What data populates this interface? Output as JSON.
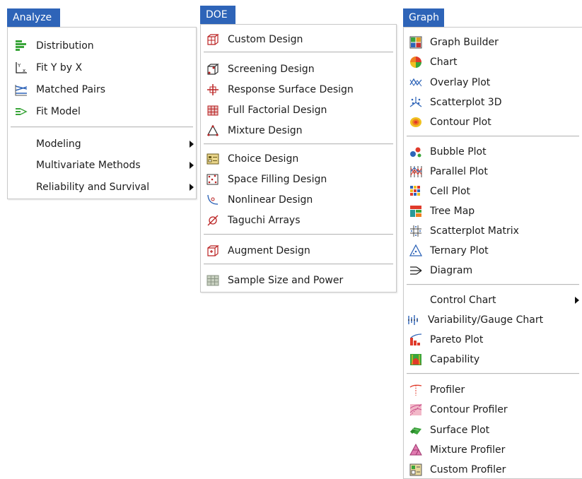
{
  "colors": {
    "title_bg": "#2e64b8",
    "title_text": "#ffffff"
  },
  "analyze": {
    "title": "Analyze",
    "items": [
      {
        "label": "Distribution",
        "icon": "distribution-icon"
      },
      {
        "label": "Fit Y by X",
        "icon": "fit-y-by-x-icon"
      },
      {
        "label": "Matched Pairs",
        "icon": "matched-pairs-icon"
      },
      {
        "label": "Fit Model",
        "icon": "fit-model-icon"
      },
      {
        "label": "Modeling"
      },
      {
        "label": "Multivariate Methods"
      },
      {
        "label": "Reliability and Survival"
      }
    ]
  },
  "doe": {
    "title": "DOE",
    "items": [
      {
        "label": "Custom Design",
        "icon": "custom-design-icon"
      },
      {
        "label": "Screening Design",
        "icon": "screening-design-icon"
      },
      {
        "label": "Response Surface Design",
        "icon": "response-surface-icon"
      },
      {
        "label": "Full Factorial Design",
        "icon": "full-factorial-icon"
      },
      {
        "label": "Mixture Design",
        "icon": "mixture-design-icon"
      },
      {
        "label": "Choice Design",
        "icon": "choice-design-icon"
      },
      {
        "label": "Space Filling Design",
        "icon": "space-filling-icon"
      },
      {
        "label": "Nonlinear Design",
        "icon": "nonlinear-design-icon"
      },
      {
        "label": "Taguchi Arrays",
        "icon": "taguchi-arrays-icon"
      },
      {
        "label": "Augment Design",
        "icon": "augment-design-icon"
      },
      {
        "label": "Sample Size and Power",
        "icon": "sample-size-icon"
      }
    ]
  },
  "graph": {
    "title": "Graph",
    "items": [
      {
        "label": "Graph Builder",
        "icon": "graph-builder-icon"
      },
      {
        "label": "Chart",
        "icon": "chart-icon"
      },
      {
        "label": "Overlay Plot",
        "icon": "overlay-plot-icon"
      },
      {
        "label": "Scatterplot 3D",
        "icon": "scatterplot-3d-icon"
      },
      {
        "label": "Contour Plot",
        "icon": "contour-plot-icon"
      },
      {
        "label": "Bubble Plot",
        "icon": "bubble-plot-icon"
      },
      {
        "label": "Parallel Plot",
        "icon": "parallel-plot-icon"
      },
      {
        "label": "Cell Plot",
        "icon": "cell-plot-icon"
      },
      {
        "label": "Tree Map",
        "icon": "tree-map-icon"
      },
      {
        "label": "Scatterplot Matrix",
        "icon": "scatterplot-matrix-icon"
      },
      {
        "label": "Ternary Plot",
        "icon": "ternary-plot-icon"
      },
      {
        "label": "Diagram",
        "icon": "diagram-icon"
      },
      {
        "label": "Control Chart"
      },
      {
        "label": "Variability/Gauge Chart",
        "icon": "variability-chart-icon"
      },
      {
        "label": "Pareto Plot",
        "icon": "pareto-plot-icon"
      },
      {
        "label": "Capability",
        "icon": "capability-icon"
      },
      {
        "label": "Profiler",
        "icon": "profiler-icon"
      },
      {
        "label": "Contour Profiler",
        "icon": "contour-profiler-icon"
      },
      {
        "label": "Surface Plot",
        "icon": "surface-plot-icon"
      },
      {
        "label": "Mixture Profiler",
        "icon": "mixture-profiler-icon"
      },
      {
        "label": "Custom Profiler",
        "icon": "custom-profiler-icon"
      }
    ]
  }
}
